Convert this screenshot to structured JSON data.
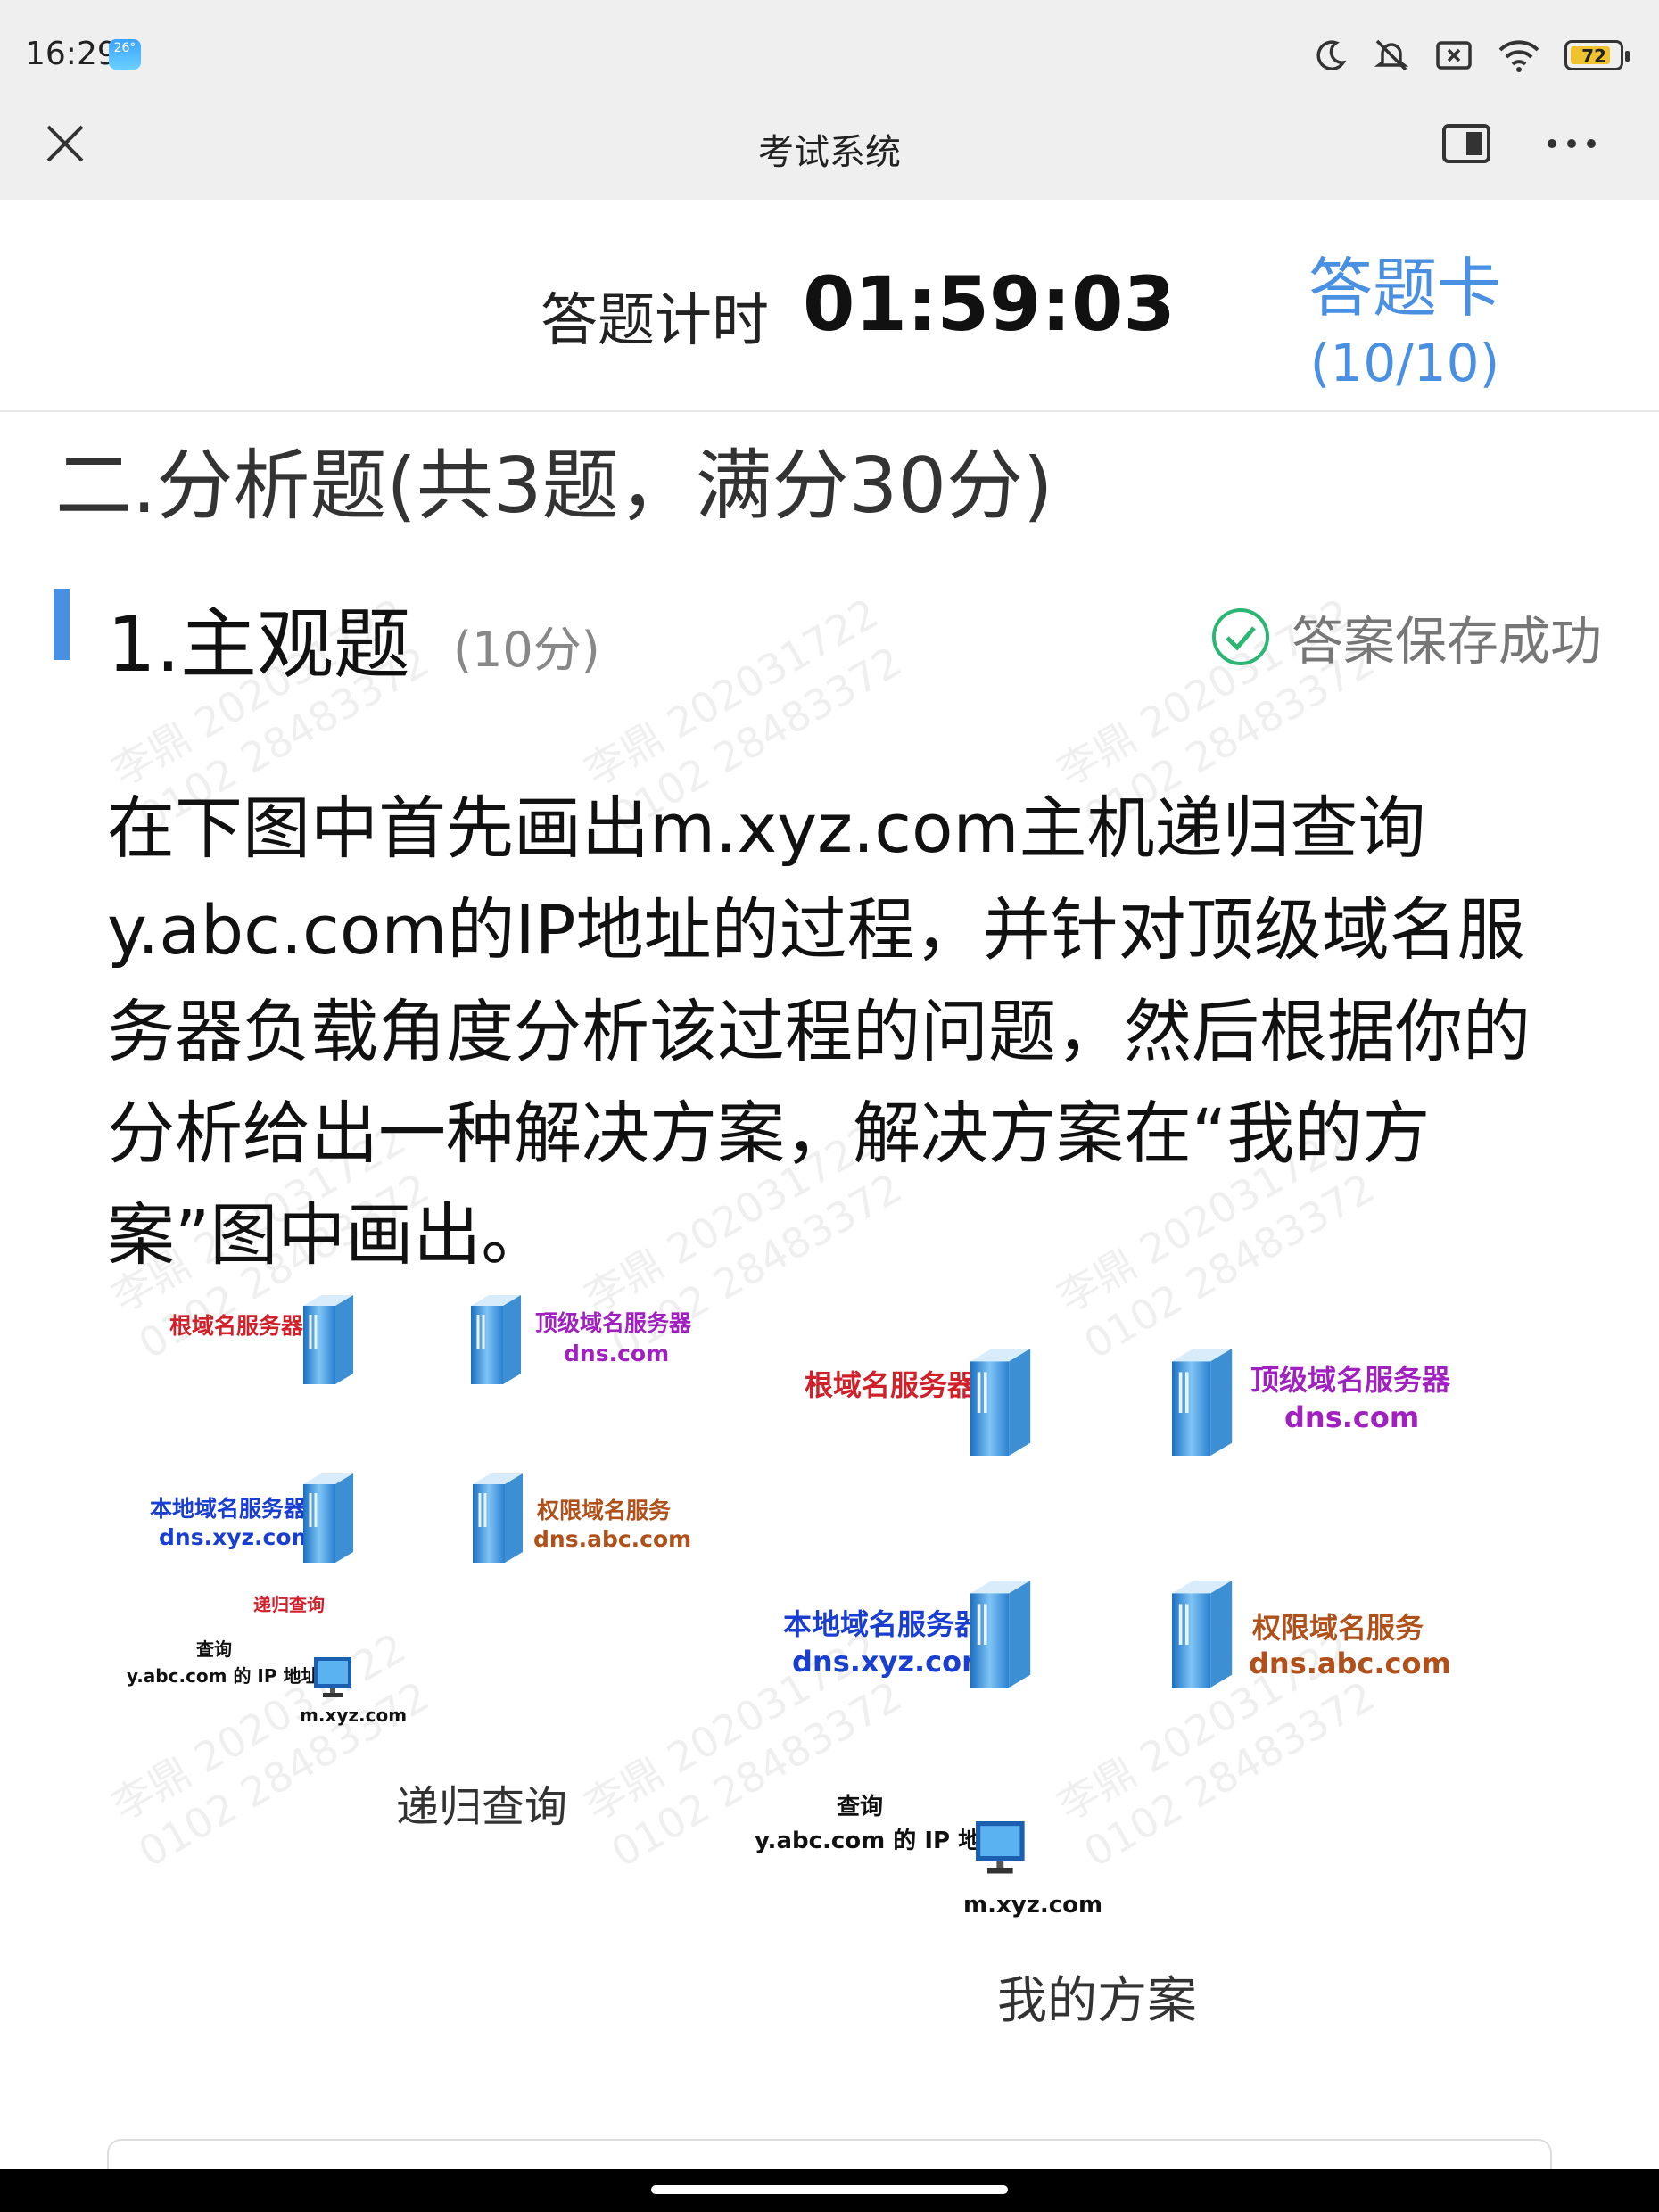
{
  "status": {
    "time": "16:29",
    "weather_badge": "26°",
    "battery": "72"
  },
  "titlebar": {
    "title": "考试系统"
  },
  "header": {
    "timer_label": "答题计时",
    "timer_value": "01:59:03",
    "card_title": "答题卡",
    "card_count": "(10/10)"
  },
  "section": {
    "title": "二.分析题(共3题，满分30分)"
  },
  "question": {
    "title": "1.主观题",
    "score": "(10分)",
    "save_status": "答案保存成功",
    "text": "在下图中首先画出m.xyz.com主机递归查询y.abc.com的IP地址的过程，并针对顶级域名服务器负载角度分析该过程的问题，然后根据你的分析给出一种解决方案，解决方案在“我的方案”图中画出。"
  },
  "watermark": {
    "name": "李鼎 202031722",
    "id": "0102 28483372"
  },
  "diagram_left": {
    "root": "根域名服务器",
    "tld": "顶级域名服务器",
    "tld_dns": "dns.com",
    "local": "本地域名服务器",
    "local_dns": "dns.xyz.com",
    "auth": "权限域名服务",
    "auth_dns": "dns.abc.com",
    "recursive_tag": "递归查询",
    "query_line1": "查询",
    "query_line2": "y.abc.com 的 IP 地址",
    "host": "m.xyz.com",
    "caption": "递归查询"
  },
  "diagram_right": {
    "root": "根域名服务器",
    "tld": "顶级域名服务器",
    "tld_dns": "dns.com",
    "local": "本地域名服务器",
    "local_dns": "dns.xyz.com",
    "auth": "权限域名服务",
    "auth_dns": "dns.abc.com",
    "query_line1": "查询",
    "query_line2": "y.abc.com 的 IP 地址",
    "host": "m.xyz.com",
    "caption": "我的方案"
  },
  "colors": {
    "accent": "#4a90e2",
    "success": "#2bb673",
    "red_label": "#d0202a",
    "purple_label": "#a020c0",
    "blue_label": "#1a3fd0",
    "brown_label": "#b0501a"
  }
}
